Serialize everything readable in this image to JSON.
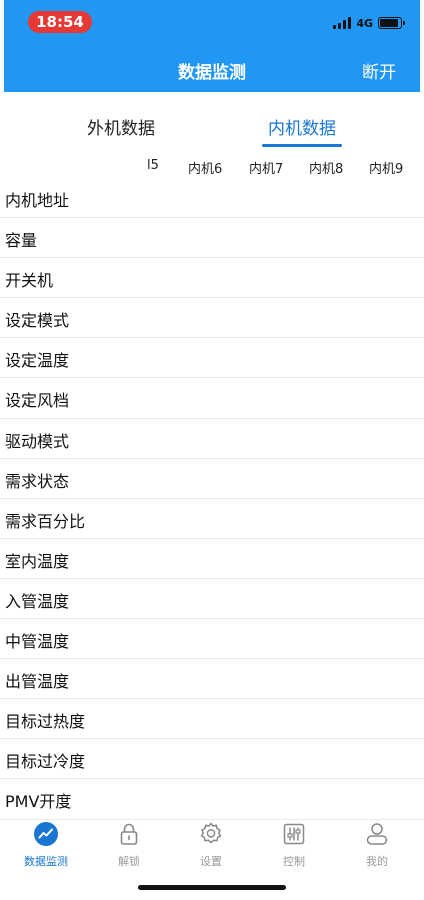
{
  "status_bar": {
    "time": "18:54",
    "network": "4G"
  },
  "header": {
    "title": "数据监测",
    "disconnect_label": "断开"
  },
  "tabs": [
    {
      "label": "外机数据",
      "active": false
    },
    {
      "label": "内机数据",
      "active": true
    }
  ],
  "unit_columns": [
    "l5",
    "内机6",
    "内机7",
    "内机8",
    "内机9"
  ],
  "params": [
    "内机地址",
    "容量",
    "开关机",
    "设定模式",
    "设定温度",
    "设定风档",
    "驱动模式",
    "需求状态",
    "需求百分比",
    "室内温度",
    "入管温度",
    "中管温度",
    "出管温度",
    "目标过热度",
    "目标过冷度",
    "PMV开度"
  ],
  "bottom_nav": [
    {
      "label": "数据监测",
      "icon": "chart-icon",
      "active": true
    },
    {
      "label": "解锁",
      "icon": "lock-icon",
      "active": false
    },
    {
      "label": "设置",
      "icon": "gear-icon",
      "active": false
    },
    {
      "label": "控制",
      "icon": "sliders-icon",
      "active": false
    },
    {
      "label": "我的",
      "icon": "person-icon",
      "active": false
    }
  ],
  "colors": {
    "header_bg": "#2196f3",
    "accent": "#1976d2",
    "time_pill": "#e53935"
  }
}
